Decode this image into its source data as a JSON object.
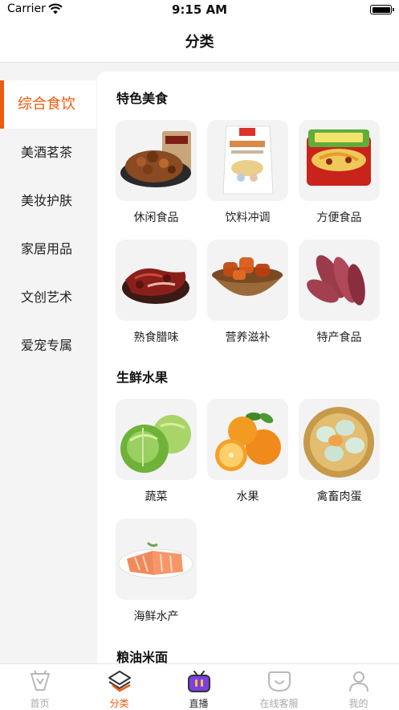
{
  "status_bar": {
    "carrier": "Carrier",
    "time": "9:15 AM"
  },
  "header": {
    "title": "分类"
  },
  "sidebar": {
    "items": [
      {
        "label": "综合食饮",
        "active": true
      },
      {
        "label": "美酒茗茶"
      },
      {
        "label": "美妆护肤"
      },
      {
        "label": "家居用品"
      },
      {
        "label": "文创艺术"
      },
      {
        "label": "爱宠专属"
      }
    ]
  },
  "sections": [
    {
      "title": "特色美食",
      "items": [
        {
          "label": "休闲食品"
        },
        {
          "label": "饮料冲调"
        },
        {
          "label": "方便食品"
        },
        {
          "label": "熟食腊味"
        },
        {
          "label": "营养滋补"
        },
        {
          "label": "特产食品"
        }
      ]
    },
    {
      "title": "生鲜水果",
      "items": [
        {
          "label": "蔬菜"
        },
        {
          "label": "水果"
        },
        {
          "label": "禽畜肉蛋"
        },
        {
          "label": "海鲜水产"
        }
      ]
    },
    {
      "title": "粮油米面"
    }
  ],
  "tabs": [
    {
      "label": "首页"
    },
    {
      "label": "分类",
      "active": true
    },
    {
      "label": "直播"
    },
    {
      "label": "在线客服"
    },
    {
      "label": "我的"
    }
  ],
  "colors": {
    "accent": "#f05a0e",
    "live_purple": "#7b3fe4",
    "inactive": "#aaaaaa"
  }
}
